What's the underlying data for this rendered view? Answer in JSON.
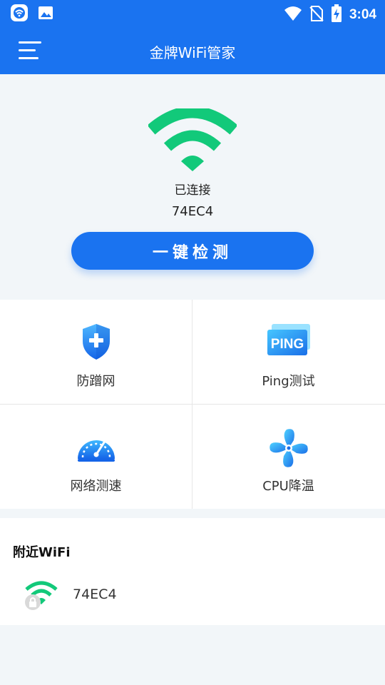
{
  "status_bar": {
    "time": "3:04",
    "icons": [
      "app-notification-icon",
      "image-notification-icon",
      "wifi-signal-icon",
      "no-sim-icon",
      "battery-charging-icon"
    ]
  },
  "app_bar": {
    "title": "金牌WiFi管家",
    "menu_icon": "hamburger-menu-icon"
  },
  "connection": {
    "status": "已连接",
    "ssid": "74EC4",
    "detect_button": "一键检测",
    "icon_color": "#12c97a"
  },
  "tools": [
    {
      "label": "防蹭网",
      "icon": "shield-plus-icon"
    },
    {
      "label": "Ping测试",
      "icon": "ping-card-icon",
      "icon_text": "PING"
    },
    {
      "label": "网络测速",
      "icon": "speedometer-icon"
    },
    {
      "label": "CPU降温",
      "icon": "fan-icon"
    }
  ],
  "nearby": {
    "title": "附近WiFi",
    "networks": [
      {
        "ssid": "74EC4",
        "icon": "locked-wifi-icon"
      }
    ]
  },
  "colors": {
    "primary": "#1a73f0",
    "wifi_green": "#12c97a",
    "background": "#f2f6f9"
  }
}
